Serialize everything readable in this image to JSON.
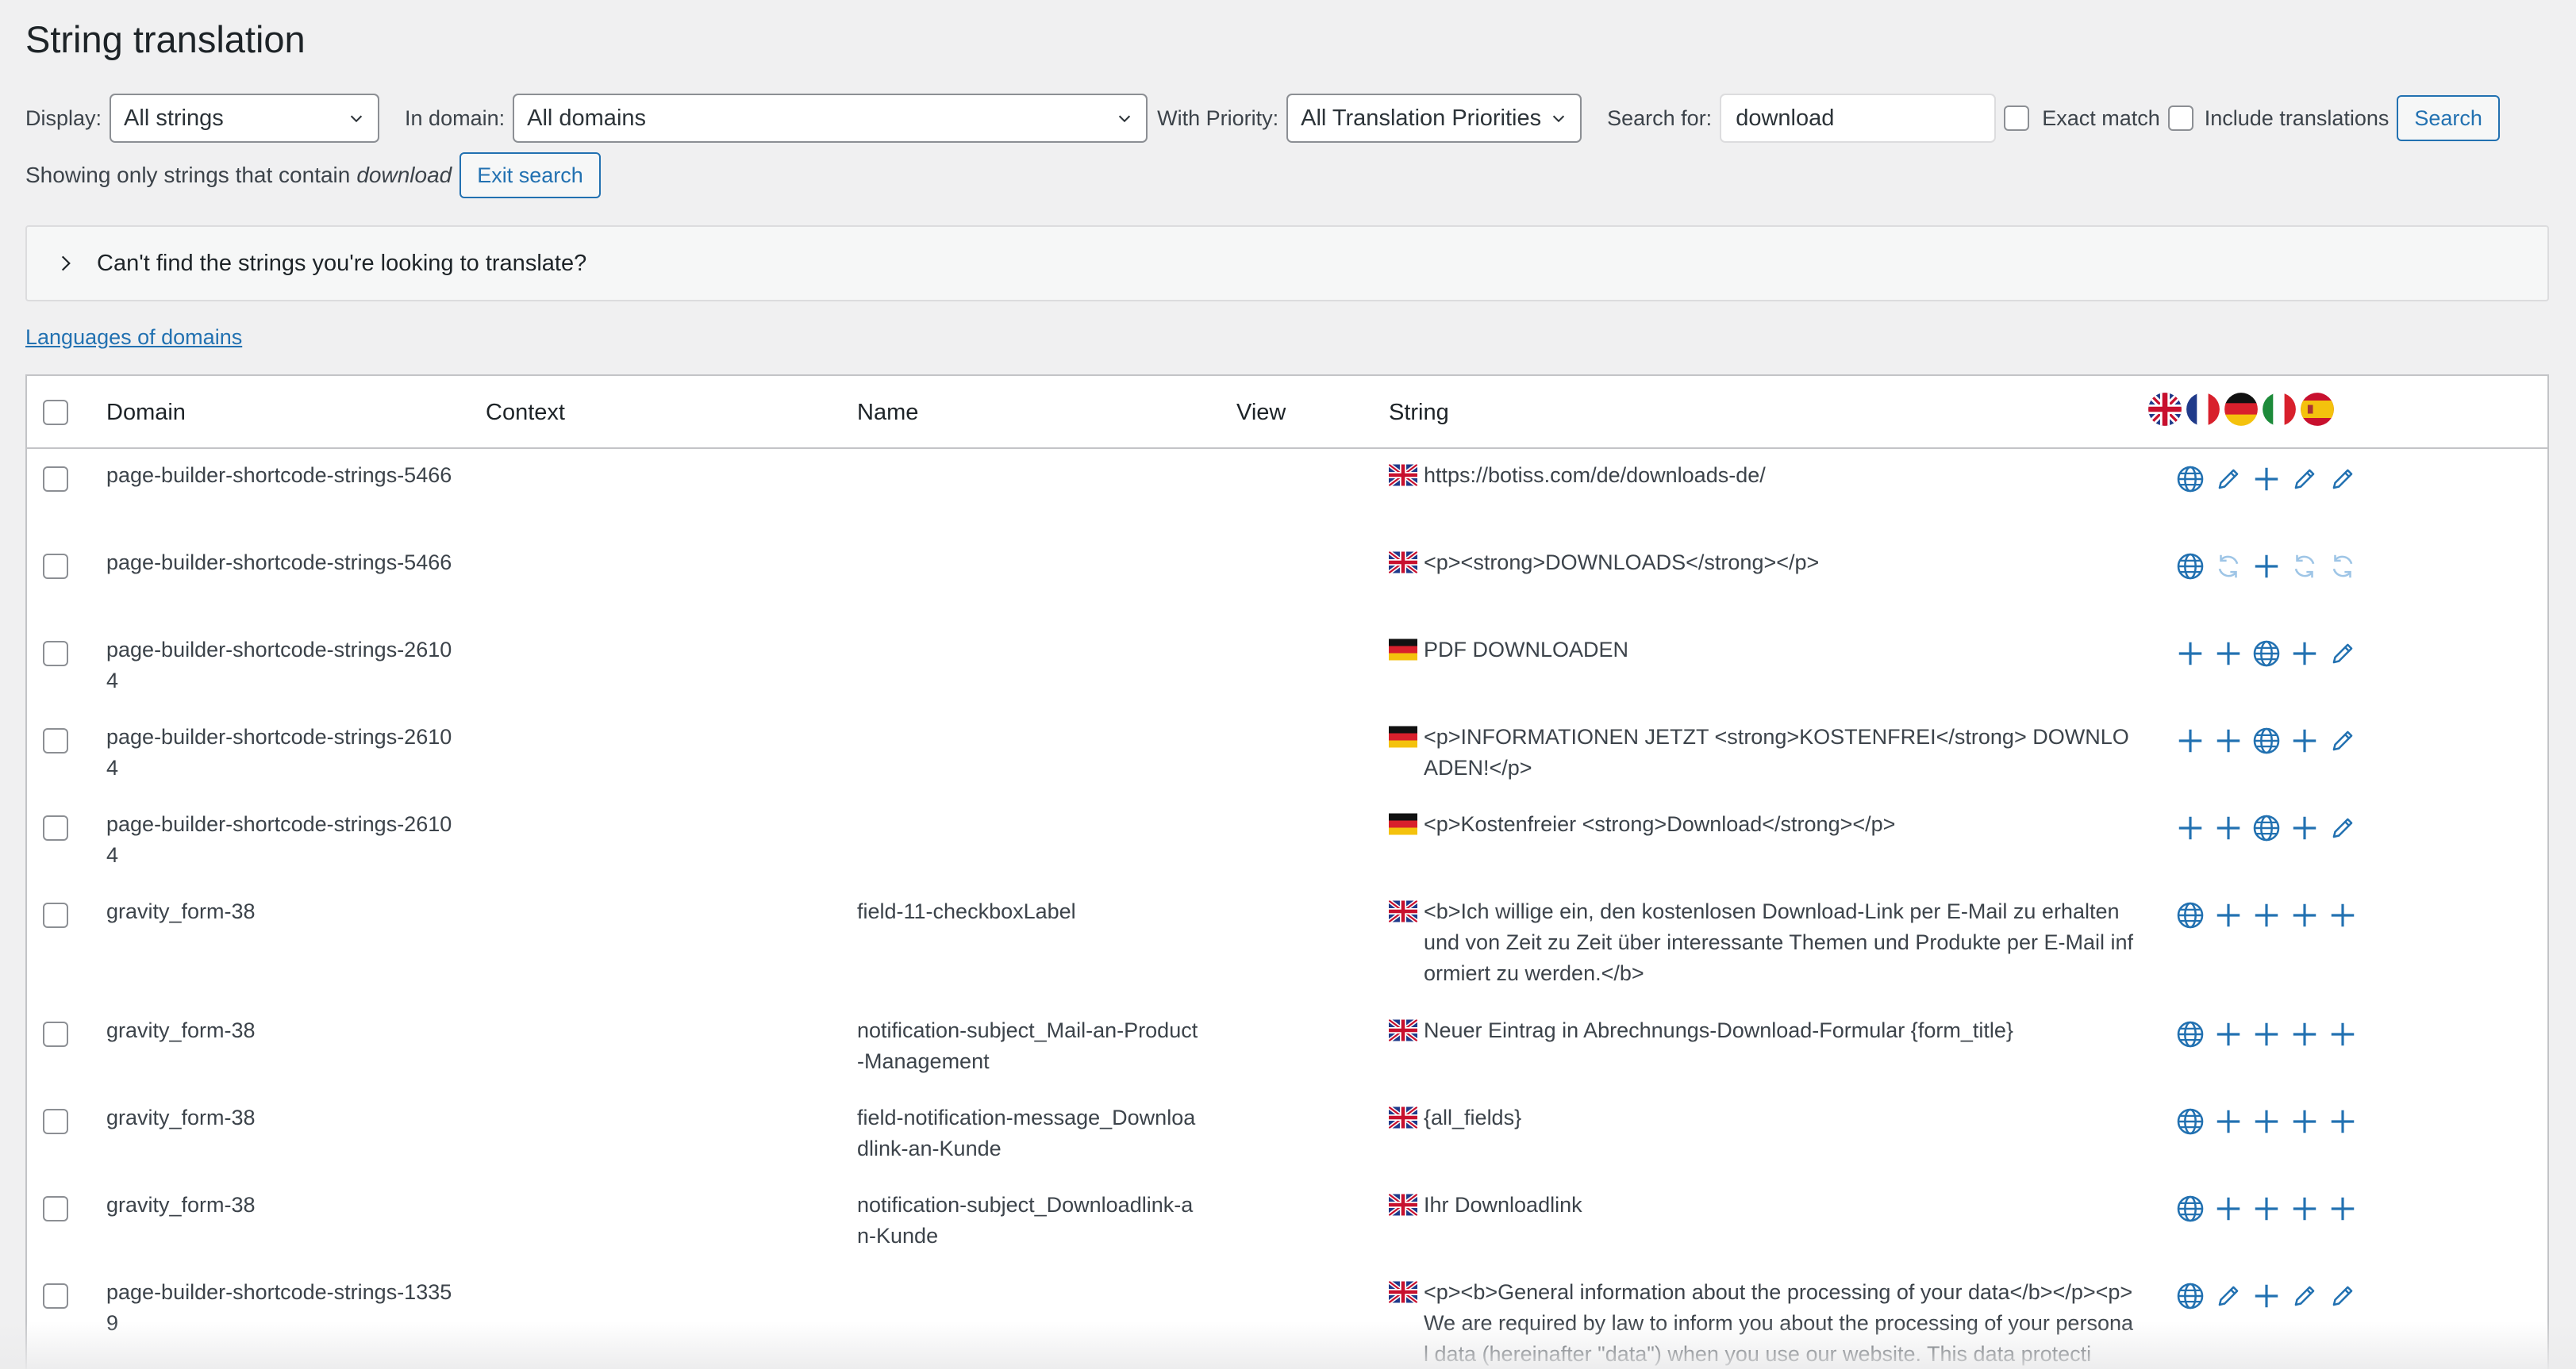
{
  "page": {
    "title": "String translation"
  },
  "filters": {
    "display_label": "Display:",
    "display_value": "All strings",
    "domain_label": "In domain:",
    "domain_value": "All domains",
    "priority_label": "With Priority:",
    "priority_value": "All Translation Priorities",
    "search_label": "Search for:",
    "search_value": "download",
    "exact_match_label": "Exact match",
    "include_translations_label": "Include translations",
    "search_button": "Search"
  },
  "search_notice": {
    "prefix": "Showing only strings that contain",
    "term": "download",
    "exit_button": "Exit search"
  },
  "accordion": {
    "label": "Can't find the strings you're looking to translate?"
  },
  "languages_link": "Languages of domains",
  "table": {
    "columns": {
      "domain": "Domain",
      "context": "Context",
      "name": "Name",
      "view": "View",
      "string": "String"
    },
    "language_flags": [
      "flag-uk-icon",
      "flag-france-icon",
      "flag-germany-icon",
      "flag-italy-icon",
      "flag-spain-icon"
    ],
    "rows": [
      {
        "domain": "page-builder-shortcode-strings-5466",
        "context": "",
        "name": "",
        "string_flag": "flag-uk-icon",
        "string": "https://botiss.com/de/downloads-de/",
        "actions": [
          "globe",
          "pencil",
          "plus",
          "pencil",
          "pencil"
        ]
      },
      {
        "domain": "page-builder-shortcode-strings-5466",
        "context": "",
        "name": "",
        "string_flag": "flag-uk-icon",
        "string": "<p><strong>DOWNLOADS</strong></p>",
        "actions": [
          "globe",
          "refresh",
          "plus",
          "refresh",
          "refresh"
        ]
      },
      {
        "domain": "page-builder-shortcode-strings-26104",
        "context": "",
        "name": "",
        "string_flag": "flag-germany-icon",
        "string": "PDF DOWNLOADEN",
        "actions": [
          "plus",
          "plus",
          "globe",
          "plus",
          "pencil"
        ]
      },
      {
        "domain": "page-builder-shortcode-strings-26104",
        "context": "",
        "name": "",
        "string_flag": "flag-germany-icon",
        "string": "<p>INFORMATIONEN JETZT <strong>KOSTENFREI</strong> DOWNLOADEN!</p>",
        "actions": [
          "plus",
          "plus",
          "globe",
          "plus",
          "pencil"
        ]
      },
      {
        "domain": "page-builder-shortcode-strings-26104",
        "context": "",
        "name": "",
        "string_flag": "flag-germany-icon",
        "string": "<p>Kostenfreier <strong>Download</strong></p>",
        "actions": [
          "plus",
          "plus",
          "globe",
          "plus",
          "pencil"
        ]
      },
      {
        "domain": "gravity_form-38",
        "context": "",
        "name": "field-11-checkboxLabel",
        "string_flag": "flag-uk-icon",
        "string": "<b>Ich willige ein, den kostenlosen Download-Link per E-Mail zu erhalten und von Zeit zu Zeit über interessante Themen und Produkte per E-Mail informiert zu werden.</b>",
        "actions": [
          "globe",
          "plus",
          "plus",
          "plus",
          "plus"
        ]
      },
      {
        "domain": "gravity_form-38",
        "context": "",
        "name": "notification-subject_Mail-an-Product-Management",
        "string_flag": "flag-uk-icon",
        "string": "Neuer Eintrag in Abrechnungs-Download-Formular {form_title}",
        "actions": [
          "globe",
          "plus",
          "plus",
          "plus",
          "plus"
        ]
      },
      {
        "domain": "gravity_form-38",
        "context": "",
        "name": "field-notification-message_Downloadlink-an-Kunde",
        "string_flag": "flag-uk-icon",
        "string": "{all_fields}",
        "actions": [
          "globe",
          "plus",
          "plus",
          "plus",
          "plus"
        ]
      },
      {
        "domain": "gravity_form-38",
        "context": "",
        "name": "notification-subject_Downloadlink-an-Kunde",
        "string_flag": "flag-uk-icon",
        "string": "Ihr Downloadlink",
        "actions": [
          "globe",
          "plus",
          "plus",
          "plus",
          "plus"
        ]
      },
      {
        "domain": "page-builder-shortcode-strings-13359",
        "context": "",
        "name": "",
        "string_flag": "flag-uk-icon",
        "string": "<p><b>General information about the processing of your data</b></p><p>We are required by law to inform you about the processing of your personal data (hereinafter \"data\") when you use our website. This data protecti",
        "actions": [
          "globe",
          "pencil",
          "plus",
          "pencil",
          "pencil"
        ]
      }
    ]
  },
  "colors": {
    "accent": "#2271b1",
    "text": "#3c434a",
    "border": "#c3c4c7"
  }
}
